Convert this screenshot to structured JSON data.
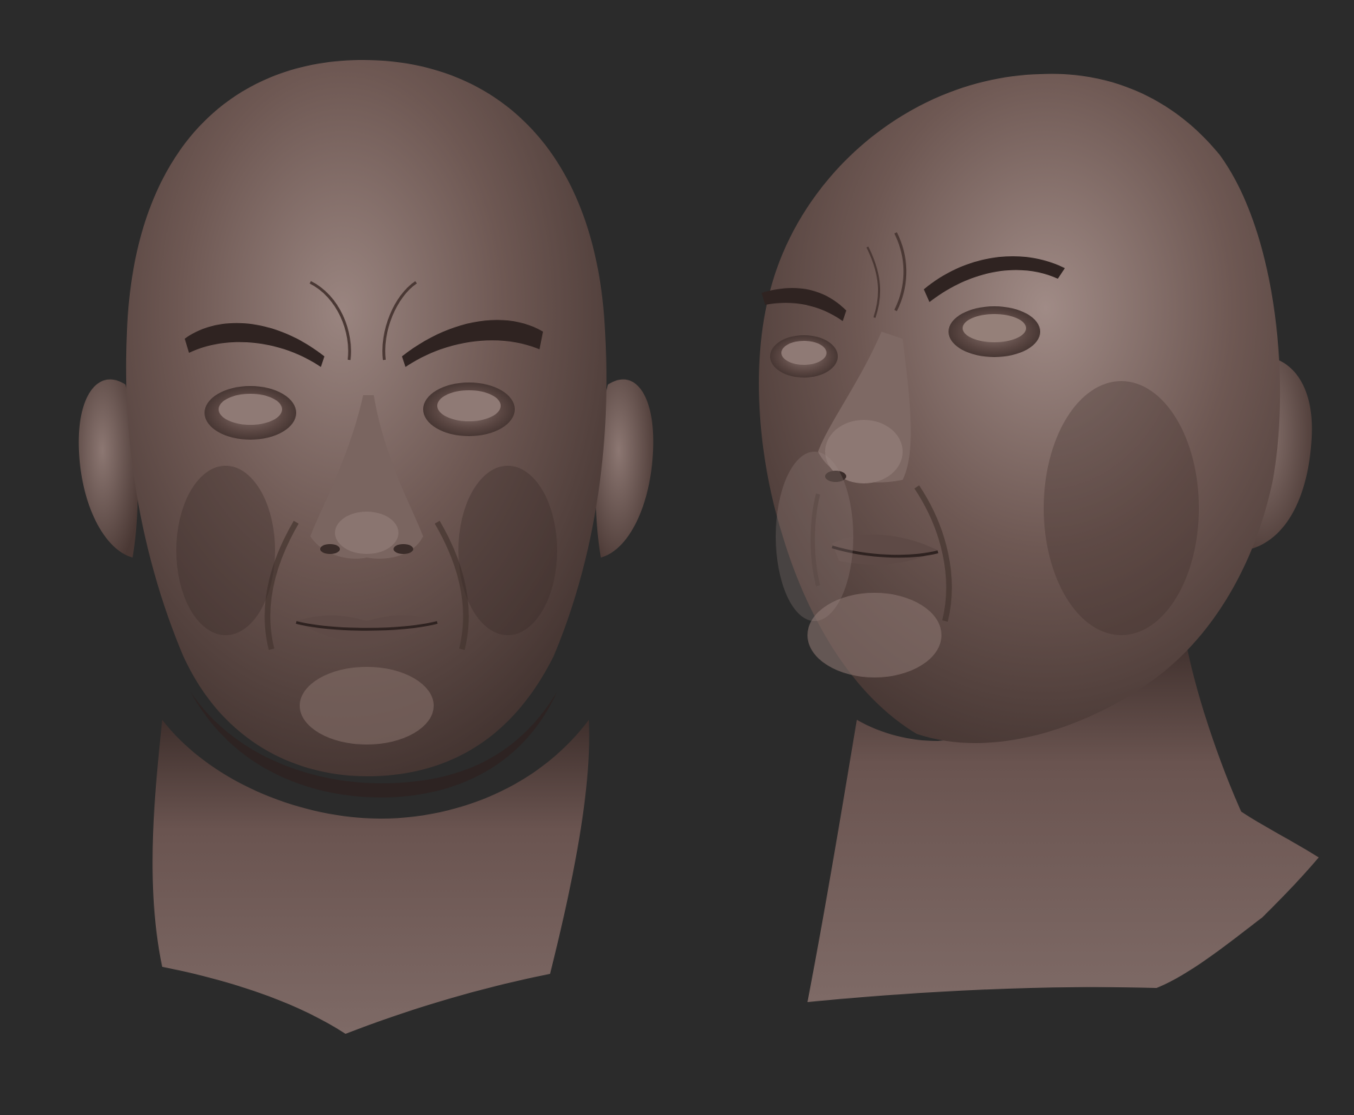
{
  "scene": {
    "background_color": "#2b2b2b",
    "material_color": "#6e5853",
    "material_highlight": "#9a8580",
    "material_shadow": "#3a2c29",
    "subjects": [
      {
        "name": "sculpt-head-front-view",
        "view": "front"
      },
      {
        "name": "sculpt-head-three-quarter-view",
        "view": "three-quarter"
      }
    ]
  }
}
